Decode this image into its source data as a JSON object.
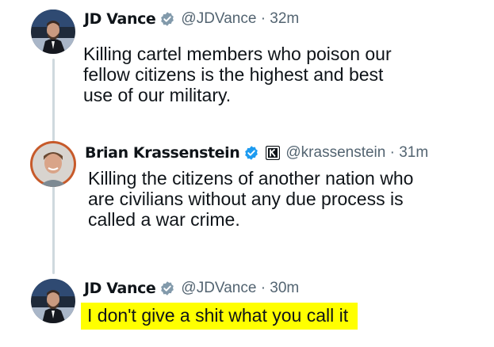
{
  "tweets": [
    {
      "name": "JD Vance",
      "handle": "@JDVance",
      "time": "32m",
      "text_lines": [
        "Killing cartel members who poison our",
        "fellow citizens is the highest and best",
        "use of our military."
      ],
      "avatar_icon": "person-portrait-icon",
      "verified_icon": "verified-gray-badge-icon"
    },
    {
      "name": "Brian Krassenstein",
      "handle": "@krassenstein",
      "time": "31m",
      "text_lines": [
        "Killing the citizens of another nation who",
        "are civilians without any due process is",
        "called a war crime."
      ],
      "avatar_icon": "person-portrait-icon",
      "verified_icon": "verified-blue-badge-icon",
      "affiliate_icon": "k-affiliate-badge-icon"
    },
    {
      "name": "JD Vance",
      "handle": "@JDVance",
      "time": "30m",
      "text_lines": [
        "I don't give a shit what you call it"
      ],
      "avatar_icon": "person-portrait-icon",
      "verified_icon": "verified-gray-badge-icon",
      "highlight_color": "#ffff00"
    }
  ],
  "separator": "·",
  "colors": {
    "text": "#0f1419",
    "secondary": "#536471",
    "thread_line": "#cfd9de",
    "verified_gray": "#829aab",
    "verified_blue": "#1d9bf0",
    "highlight": "#ffff00"
  }
}
